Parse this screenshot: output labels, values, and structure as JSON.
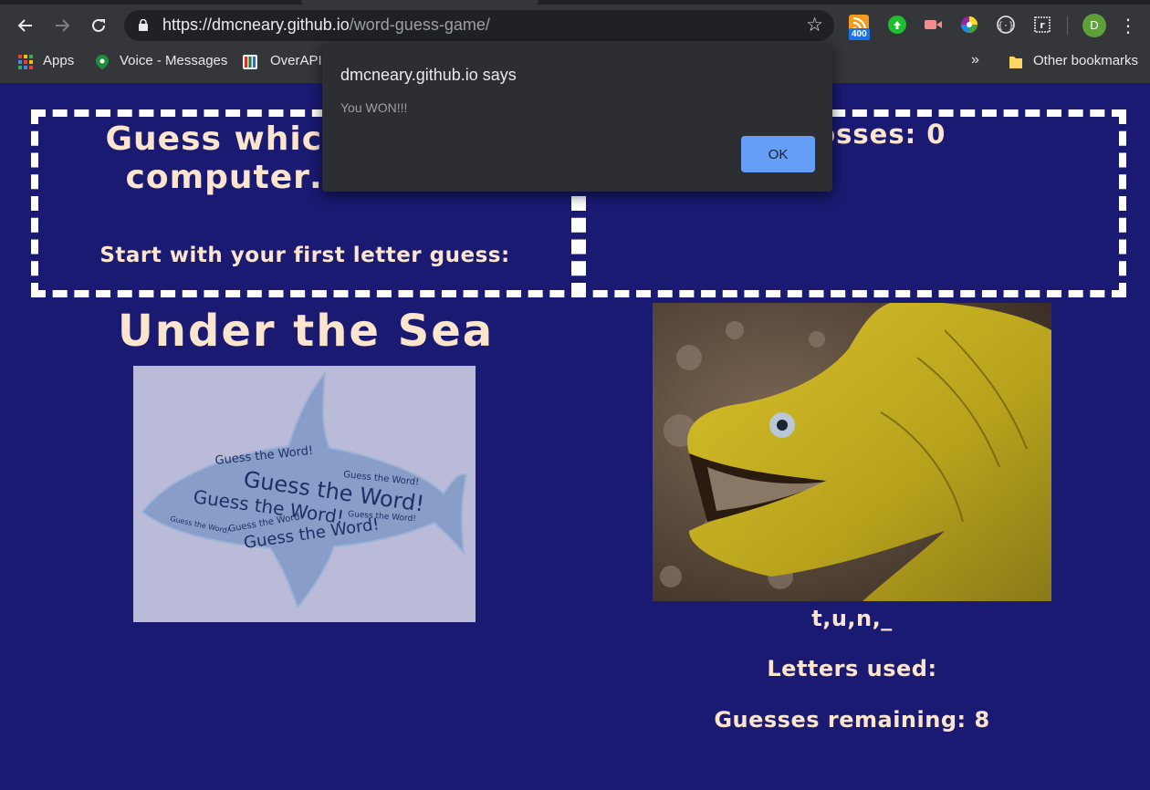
{
  "browser": {
    "url_host": "https://dmcneary.github.io",
    "url_path": "/word-guess-game/",
    "extension_badge": "400",
    "profile_initial": "D",
    "bookmarks": {
      "apps": "Apps",
      "voice": "Voice - Messages",
      "overapi": "OverAPI.",
      "more": "»",
      "other": "Other bookmarks"
    },
    "icons": [
      "back-icon",
      "forward-icon",
      "reload-icon",
      "lock-icon",
      "star-icon",
      "rss-extension-icon",
      "green-extension-icon",
      "video-extension-icon",
      "color-wheel-extension-icon",
      "code-extension-icon",
      "r-extension-icon",
      "menu-icon",
      "apps-grid-icon",
      "voice-icon",
      "overapi-icon",
      "folder-icon"
    ]
  },
  "dialog": {
    "title": "dmcneary.github.io says",
    "message": "You WON!!!",
    "ok_label": "OK"
  },
  "game": {
    "headline": "Guess which m… the computer… about!",
    "subhead": "Start with your first letter guess:",
    "scoreline": "2 Losses: 0",
    "theme_title": "Under the Sea",
    "shark_text": "Guess the Word!",
    "word_display": "t,u,n,_",
    "letters_used": "Letters used:",
    "guesses_remaining": "Guesses remaining: 8"
  },
  "colors": {
    "page_background": "#1a1a72",
    "heading_text": "#fce5cd",
    "dashed_border": "#ffffff",
    "dialog_background": "#2d2e31",
    "ok_button": "#669df6",
    "shark_card": "#b9bbd8"
  }
}
